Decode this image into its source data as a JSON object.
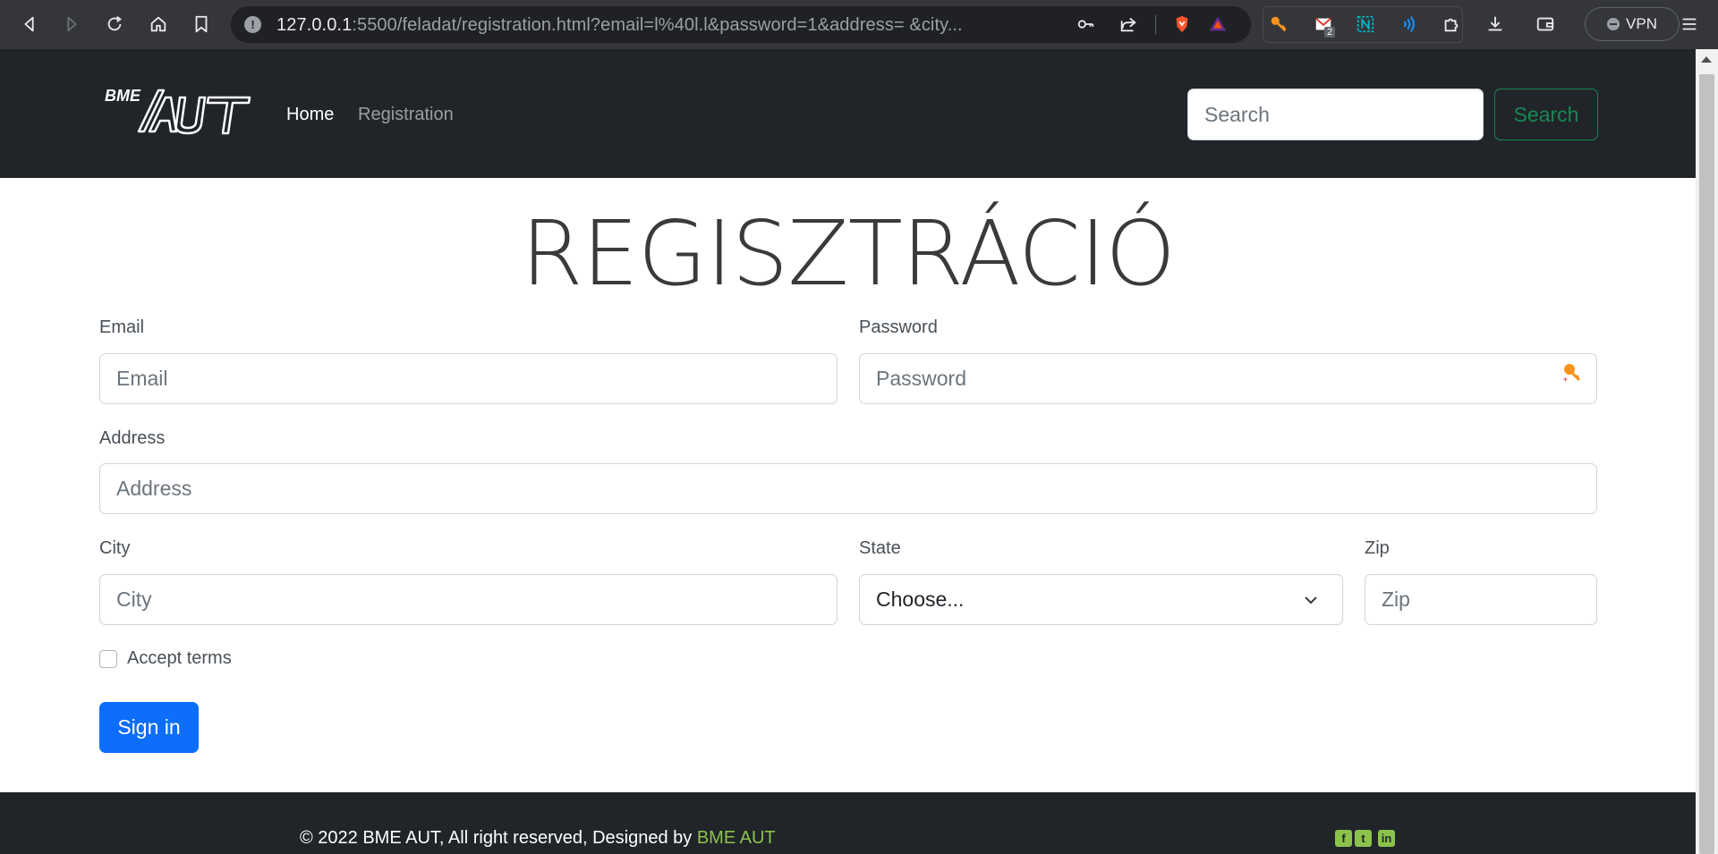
{
  "browser": {
    "url_host": "127.0.0.1",
    "url_rest": ":5500/feladat/registration.html?email=l%40l.l&password=1&address=          &city...",
    "vpn_label": "VPN",
    "mail_badge": "2"
  },
  "navbar": {
    "logo_text": "BME",
    "home_label": "Home",
    "registration_label": "Registration",
    "search_placeholder": "Search",
    "search_button": "Search"
  },
  "page": {
    "title": "REGISZTRÁCIÓ"
  },
  "form": {
    "email_label": "Email",
    "email_placeholder": "Email",
    "password_label": "Password",
    "password_placeholder": "Password",
    "address_label": "Address",
    "address_placeholder": "Address",
    "city_label": "City",
    "city_placeholder": "City",
    "state_label": "State",
    "state_selected": "Choose...",
    "zip_label": "Zip",
    "zip_placeholder": "Zip",
    "terms_label": "Accept terms",
    "submit_label": "Sign in"
  },
  "footer": {
    "copyright": "© 2022 BME AUT, All right reserved, Designed by ",
    "brand_link": "BME AUT"
  },
  "colors": {
    "navbar_bg": "#212529",
    "primary": "#0d6efd",
    "success": "#198754",
    "footer_accent": "#8bc34a"
  }
}
